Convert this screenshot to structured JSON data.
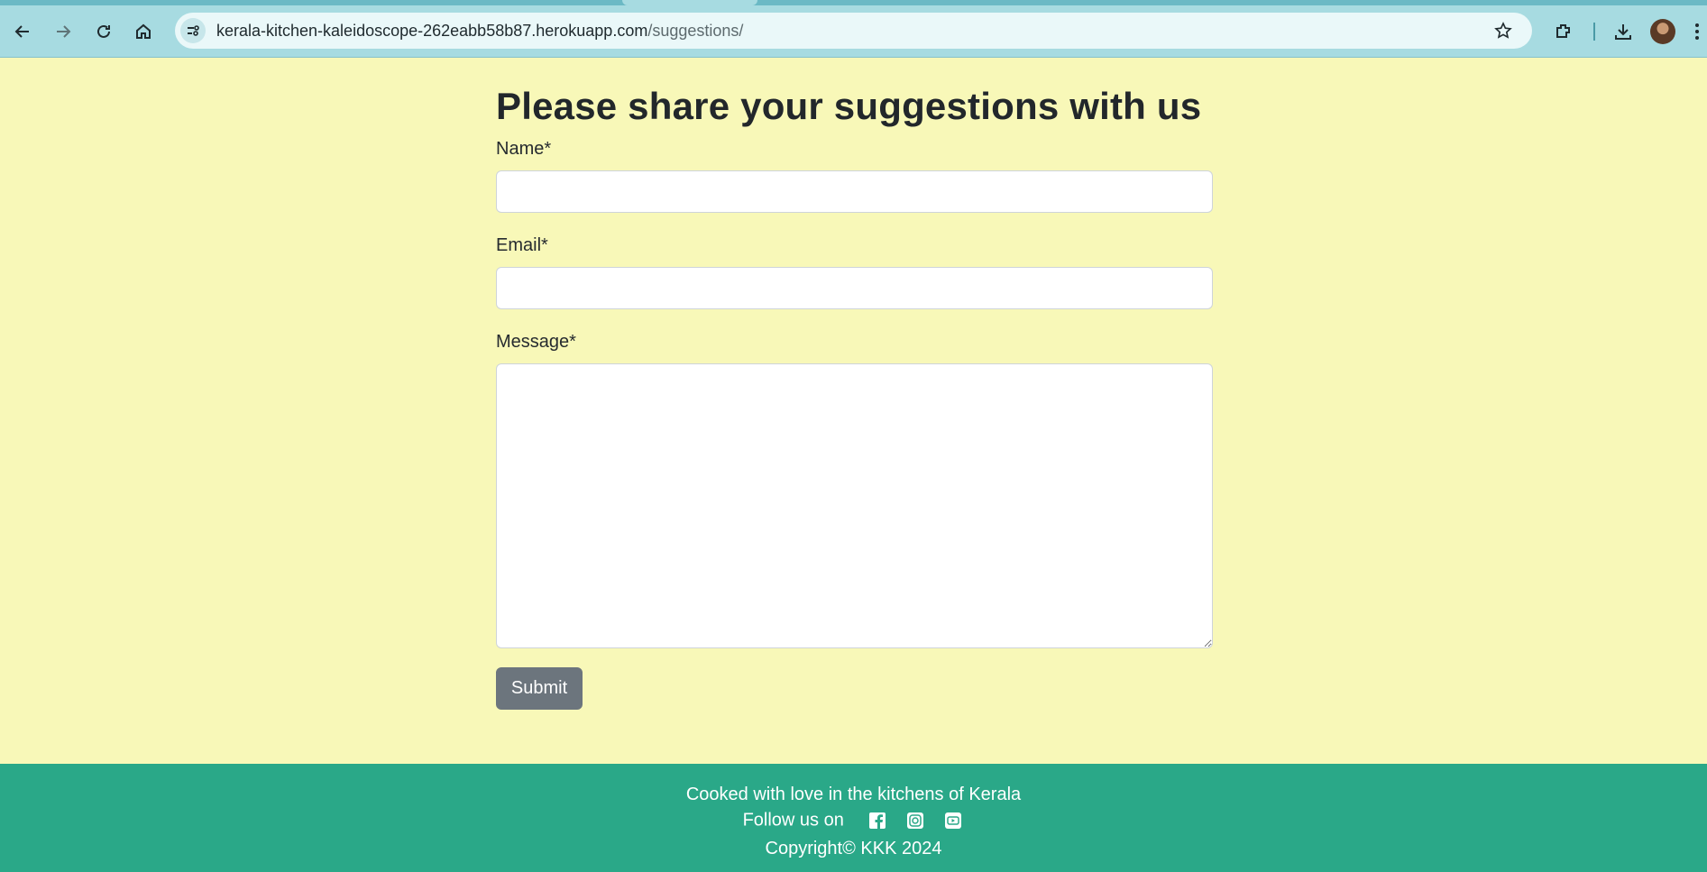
{
  "browser": {
    "url_host": "kerala-kitchen-kaleidoscope-262eabb58b87.herokuapp.com",
    "url_path": "/suggestions/",
    "icons": [
      "back-icon",
      "forward-icon",
      "reload-icon",
      "home-icon",
      "site-info-icon",
      "bookmark-star-icon",
      "extensions-icon",
      "download-icon",
      "profile-avatar",
      "menu-icon"
    ]
  },
  "form": {
    "heading": "Please share your suggestions with us",
    "name_label": "Name*",
    "email_label": "Email*",
    "message_label": "Message*",
    "submit_label": "Submit"
  },
  "footer": {
    "tagline": "Cooked with love in the kitchens of Kerala",
    "follow_label": "Follow us on",
    "social_icons": [
      "facebook-icon",
      "instagram-icon",
      "youtube-icon"
    ],
    "copyright": "Copyright© KKK 2024"
  },
  "colors": {
    "page_background": "#f8f8b8",
    "footer_background": "#2aa888",
    "submit_button": "#6c757d",
    "browser_chrome": "#a7dbe1"
  }
}
